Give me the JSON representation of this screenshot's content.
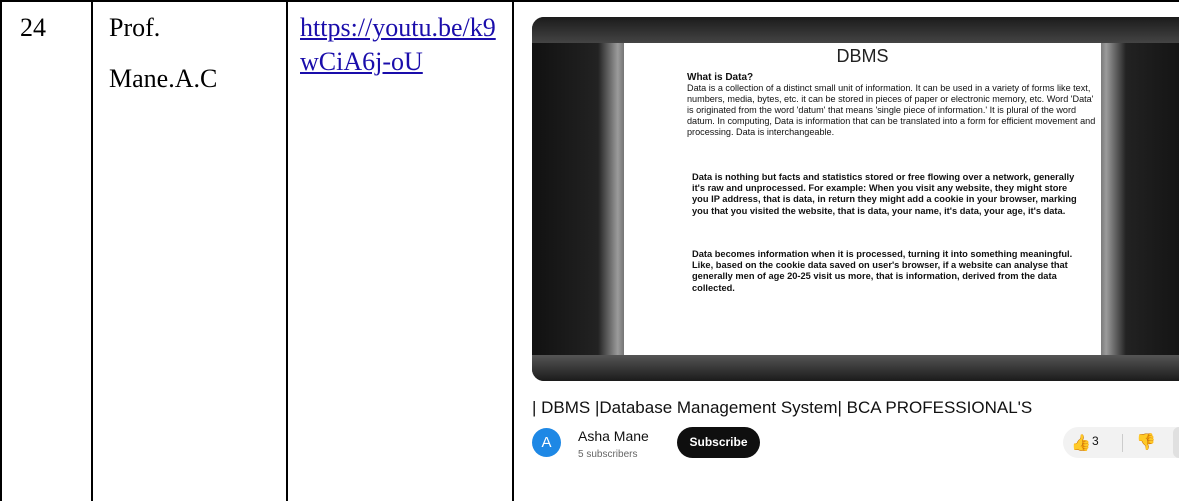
{
  "table": {
    "row_number": "24",
    "faculty": [
      "Prof.",
      "Mane.A.C"
    ],
    "link_text": "https://youtu.be/k9wCiA6j-oU"
  },
  "video": {
    "slide_title": "DBMS",
    "slide_subtitle": "What is Data?",
    "slide_paragraph_1": "Data is a collection of a distinct small unit of information. It can be used in a variety of forms like text, numbers, media, bytes, etc. it can be stored in pieces of paper or electronic memory, etc. Word 'Data' is originated from the word 'datum' that means 'single piece of information.' It is plural of the word datum. In computing, Data is information that can be translated into a form for efficient movement and processing. Data is interchangeable.",
    "slide_paragraph_2": "Data is nothing but facts and statistics stored or free flowing over a network, generally it's raw and unprocessed. For example: When you visit any website, they might store you IP address, that is data, in return they might add a cookie in your browser, marking you that you visited the website, that is data, your name, it's data, your age, it's data.",
    "slide_paragraph_3": "Data becomes information when it is processed, turning it into something meaningful. Like, based on the cookie data saved on user's browser, if a website can analyse that generally men of age 20-25 visit us more, that is information, derived from the data collected.",
    "title": "| DBMS |Database Management System| BCA PROFESSIONAL'S",
    "channel_initial": "A",
    "channel_name": "Asha Mane",
    "subscribers": "5 subscribers",
    "subscribe_label": "Subscribe",
    "like_count": "3",
    "like_icon": "thumbs-up-icon",
    "dislike_icon": "thumbs-down-icon"
  },
  "colors": {
    "link": "#1a0dab",
    "avatar": "#1e88e5",
    "subscribe_bg": "#0f0f0f"
  }
}
